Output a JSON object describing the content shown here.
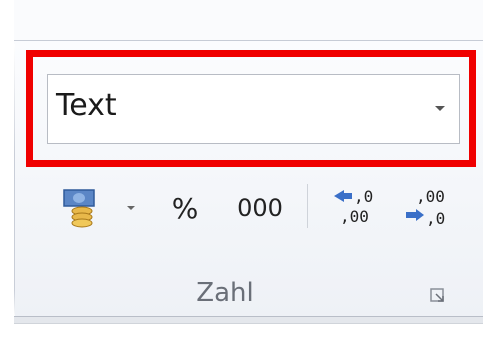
{
  "number_group": {
    "format_combo": {
      "value": "Text"
    },
    "buttons": {
      "currency_icon": "accounting-number-format-icon",
      "percent_label": "%",
      "thousands_label": "000",
      "increase_decimal_icon": "increase-decimal-icon",
      "decrease_decimal_icon": "decrease-decimal-icon"
    },
    "group_label": "Zahl",
    "launcher_icon": "dialog-launcher-icon",
    "highlight_color": "#f00000"
  }
}
